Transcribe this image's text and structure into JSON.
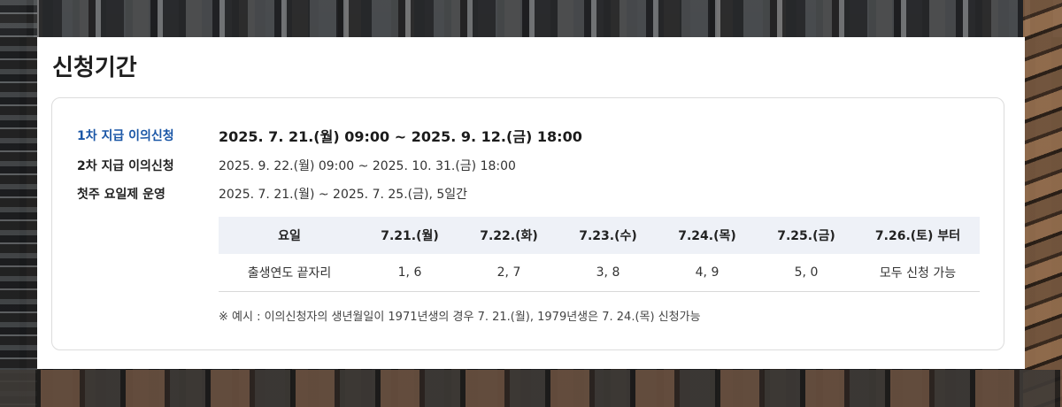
{
  "section_title": "신청기간",
  "periods": [
    {
      "label": "1차 지급 이의신청",
      "value": "2025. 7. 21.(월) 09:00 ~ 2025. 9. 12.(금) 18:00"
    },
    {
      "label": "2차 지급 이의신청",
      "value": "2025. 9. 22.(월) 09:00 ~ 2025. 10. 31.(금) 18:00"
    },
    {
      "label": "첫주 요일제 운영",
      "value": "2025. 7. 21.(월) ~ 2025. 7. 25.(금), 5일간"
    }
  ],
  "schedule": {
    "headers": [
      "요일",
      "7.21.(월)",
      "7.22.(화)",
      "7.23.(수)",
      "7.24.(목)",
      "7.25.(금)",
      "7.26.(토) 부터"
    ],
    "row": [
      "출생연도 끝자리",
      "1, 6",
      "2, 7",
      "3, 8",
      "4, 9",
      "5, 0",
      "모두 신청 가능"
    ]
  },
  "note": "※ 예시 : 이의신청자의 생년월일이 1971년생의 경우 7. 21.(월), 1979년생은 7. 24.(목) 신청가능",
  "colors": {
    "accent": "#1a56a6",
    "table_header_bg": "#eef1f7"
  }
}
